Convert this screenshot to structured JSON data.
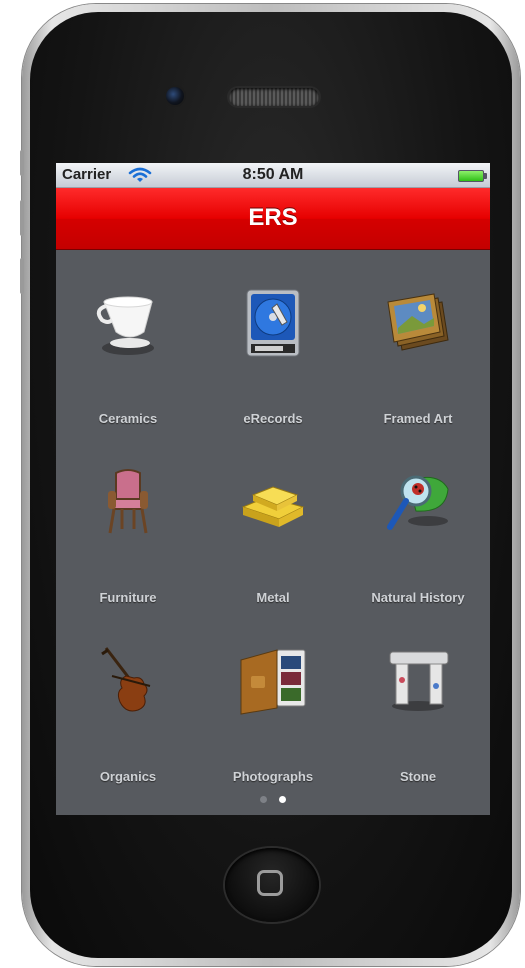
{
  "status_bar": {
    "carrier": "Carrier",
    "time": "8:50 AM"
  },
  "nav_bar": {
    "title": "ERS"
  },
  "grid_items": [
    {
      "label": "Ceramics",
      "icon": "teacup-icon"
    },
    {
      "label": "eRecords",
      "icon": "hard-drive-icon"
    },
    {
      "label": "Framed Art",
      "icon": "framed-pictures-icon"
    },
    {
      "label": "Furniture",
      "icon": "armchair-icon"
    },
    {
      "label": "Metal",
      "icon": "gold-bars-icon"
    },
    {
      "label": "Natural History",
      "icon": "magnifier-leaf-icon"
    },
    {
      "label": "Organics",
      "icon": "violin-icon"
    },
    {
      "label": "Photographs",
      "icon": "photo-album-icon"
    },
    {
      "label": "Stone",
      "icon": "stone-pillars-icon"
    }
  ],
  "page_control": {
    "pages": 2,
    "current": 2
  },
  "colors": {
    "nav_red": "#e60000",
    "screen_bg": "#575a5f",
    "label": "#cfd2d6"
  }
}
